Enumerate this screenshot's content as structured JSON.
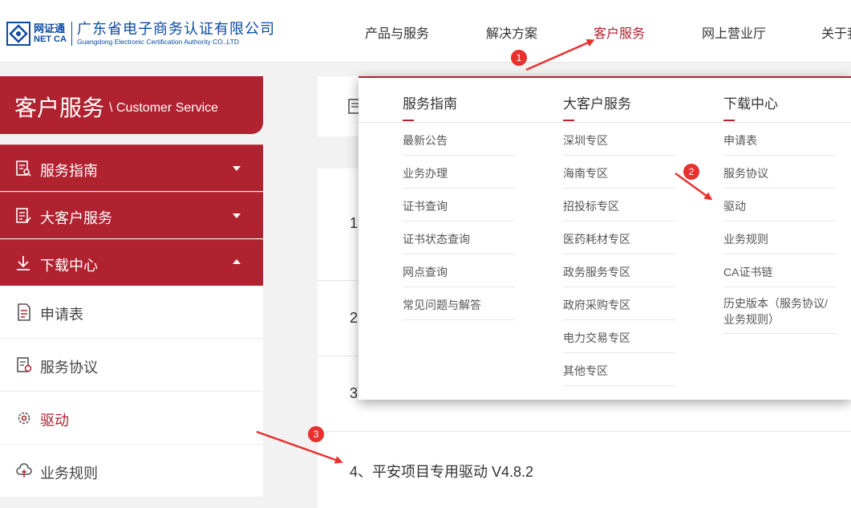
{
  "logo": {
    "mark_cn": "网证通",
    "mark_en": "NET CA",
    "company_cn": "广东省电子商务认证有限公司",
    "company_en": "Guangdong Electronic Certification Authority CO.,LTD"
  },
  "nav": {
    "items": [
      {
        "label": "产品与服务"
      },
      {
        "label": "解决方案"
      },
      {
        "label": "客户服务"
      },
      {
        "label": "网上营业厅"
      },
      {
        "label": "关于我"
      }
    ]
  },
  "sidebar": {
    "title_cn": "客户服务",
    "title_en": "\\ Customer Service",
    "categories": [
      {
        "label": "服务指南"
      },
      {
        "label": "大客户服务"
      },
      {
        "label": "下载中心"
      }
    ],
    "sub_items": [
      {
        "label": "申请表"
      },
      {
        "label": "服务协议"
      },
      {
        "label": "驱动"
      },
      {
        "label": "业务规则"
      }
    ]
  },
  "main": {
    "rows": [
      {
        "label": "1"
      },
      {
        "label": "2"
      },
      {
        "label": "3"
      },
      {
        "label": "4、平安项目专用驱动 V4.8.2"
      }
    ]
  },
  "dropdown": {
    "columns": [
      {
        "heading": "服务指南",
        "items": [
          "最新公告",
          "业务办理",
          "证书查询",
          "证书状态查询",
          "网点查询",
          "常见问题与解答"
        ]
      },
      {
        "heading": "大客户服务",
        "items": [
          "深圳专区",
          "海南专区",
          "招投标专区",
          "医药耗材专区",
          "政务服务专区",
          "政府采购专区",
          "电力交易专区",
          "其他专区"
        ]
      },
      {
        "heading": "下载中心",
        "items": [
          "申请表",
          "服务协议",
          "驱动",
          "业务规则",
          "CA证书链",
          "历史版本（服务协议/业务规则）"
        ]
      }
    ]
  },
  "annotations": {
    "badges": [
      "1",
      "2",
      "3"
    ],
    "color": "#e8312f"
  },
  "colors": {
    "brand_red": "#b0222f",
    "logo_blue": "#0b4aa2"
  }
}
